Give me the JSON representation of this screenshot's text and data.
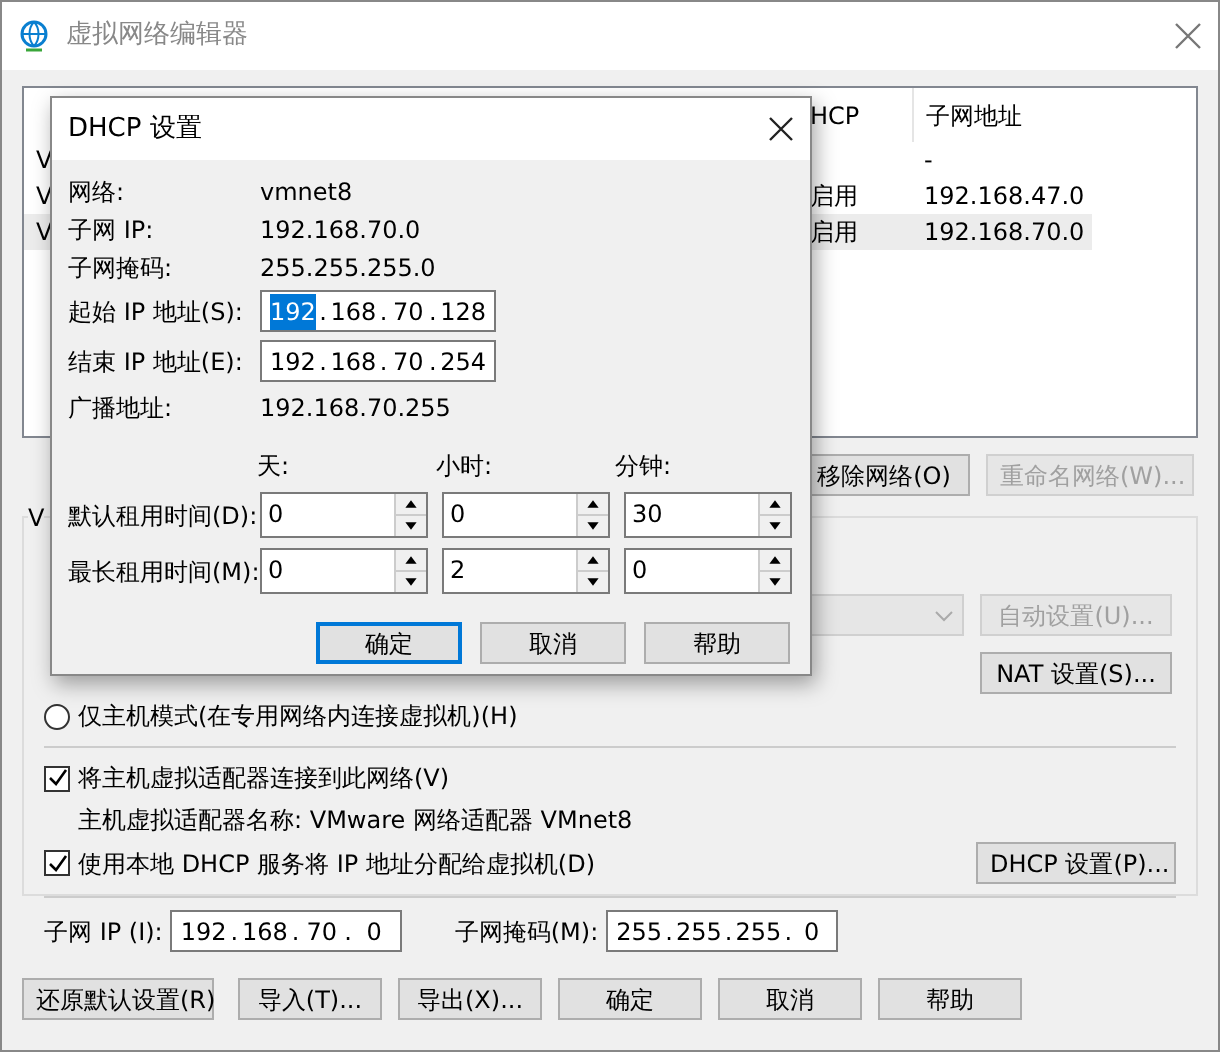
{
  "window": {
    "title": "虚拟网络编辑器"
  },
  "network_table": {
    "columns": [
      "HCP",
      "子网地址"
    ],
    "rows": [
      {
        "name": "V",
        "subnet": "-",
        "selected": false
      },
      {
        "name": "V",
        "dhcp": "启用",
        "subnet": "192.168.47.0",
        "selected": false
      },
      {
        "name": "V",
        "dhcp": "启用",
        "subnet": "192.168.70.0",
        "selected": true
      }
    ]
  },
  "table_buttons": [
    {
      "label": "移除网络(O)",
      "disabled": false
    },
    {
      "label": "重命名网络(W)...",
      "disabled": true
    }
  ],
  "vmnet_info": {
    "group_title": "V",
    "nat_buttons": [
      {
        "label": "自动设置(U)...",
        "disabled": true
      },
      {
        "label": "NAT 设置(S)...",
        "disabled": false
      }
    ],
    "host_only_radio": {
      "label": "仅主机模式(在专用网络内连接虚拟机)(H)",
      "selected": false
    },
    "connect_adapter": {
      "label": "将主机虚拟适配器连接到此网络(V)",
      "checked": true
    },
    "adapter_name": "主机虚拟适配器名称: VMware 网络适配器 VMnet8",
    "use_dhcp": {
      "label": "使用本地 DHCP 服务将 IP 地址分配给虚拟机(D)",
      "checked": true
    },
    "dhcp_button": "DHCP 设置(P)...",
    "subnet_ip": {
      "label": "子网 IP (I):",
      "separator": ".",
      "octets": [
        {
          "text": "192",
          "selected": false
        },
        {
          "text": "168",
          "selected": false
        },
        {
          "text": "70",
          "selected": false
        },
        {
          "text": "0",
          "selected": false
        }
      ]
    },
    "subnet_mask": {
      "label": "子网掩码(M):",
      "separator": ".",
      "octets": [
        {
          "text": "255",
          "selected": false
        },
        {
          "text": "255",
          "selected": false
        },
        {
          "text": "255",
          "selected": false
        },
        {
          "text": "0",
          "selected": false
        }
      ]
    }
  },
  "bottom_buttons": [
    "还原默认设置(R)",
    "导入(T)...",
    "导出(X)...",
    "确定",
    "取消",
    "帮助"
  ],
  "dhcp_dialog": {
    "title": "DHCP 设置",
    "info": [
      {
        "label": "网络:",
        "value": "vmnet8"
      },
      {
        "label": "子网 IP:",
        "value": "192.168.70.0"
      },
      {
        "label": "子网掩码:",
        "value": "255.255.255.0"
      }
    ],
    "start_ip": {
      "label": "起始 IP 地址(S):",
      "separator": ".",
      "octets": [
        {
          "text": "192",
          "selected": true
        },
        {
          "text": "168",
          "selected": false
        },
        {
          "text": "70",
          "selected": false
        },
        {
          "text": "128",
          "selected": false
        }
      ]
    },
    "end_ip": {
      "label": "结束 IP 地址(E):",
      "separator": ".",
      "octets": [
        {
          "text": "192",
          "selected": false
        },
        {
          "text": "168",
          "selected": false
        },
        {
          "text": "70",
          "selected": false
        },
        {
          "text": "254",
          "selected": false
        }
      ]
    },
    "broadcast": {
      "label": "广播地址:",
      "value": "192.168.70.255"
    },
    "time_columns": [
      "天:",
      "小时:",
      "分钟:"
    ],
    "lease_rows": [
      {
        "label": "默认租用时间(D):",
        "values": [
          "0",
          "0",
          "30"
        ]
      },
      {
        "label": "最长租用时间(M):",
        "values": [
          "0",
          "2",
          "0"
        ]
      }
    ],
    "buttons": [
      {
        "label": "确定",
        "default": true
      },
      {
        "label": "取消",
        "default": false
      },
      {
        "label": "帮助",
        "default": false
      }
    ]
  }
}
